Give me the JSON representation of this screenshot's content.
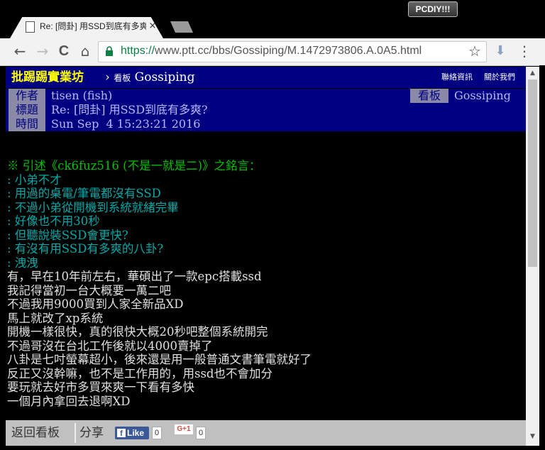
{
  "badge": "PCDIY!!!",
  "tab": {
    "title": "Re: [問卦] 用SSD到底有多爽",
    "close": "×"
  },
  "toolbar": {
    "back": "←",
    "forward": "→",
    "reload": "C",
    "home": "⌂",
    "url_scheme": "https://",
    "url_rest": "www.ptt.cc/bbs/Gossiping/M.1472973806.A.0A5.html",
    "star": "☆",
    "download": "⬇",
    "menu": "⋮"
  },
  "header": {
    "site": "批踢踢實業坊",
    "arrow": "›",
    "board_label": "看板",
    "board": "Gossiping",
    "contact": "聯絡資訊",
    "about": "關於我們"
  },
  "meta": {
    "author_tag": "作者",
    "author": "tisen (fish)",
    "board_tag": "看板",
    "board": "Gossiping",
    "title_tag": "標題",
    "title": "Re: [問卦] 用SSD到底有多爽?",
    "time_tag": "時間",
    "time": "Sun Sep  4 15:23:21 2016"
  },
  "quote_header": "※ 引述《ck6fuz516 (不是一就是二)》之銘言：",
  "quotes": [
    ": 小弟不才",
    ": 用過的桌電/筆電都沒有SSD",
    ": 不過小弟從開機到系統就緒完畢",
    ": 好像也不用30秒",
    ": 但聽說裝SSD會更快?",
    ": 有沒有用SSD有多爽的八卦?",
    ": 洩洩"
  ],
  "body": [
    "有，早在10年前左右，華碩出了一款epc搭載ssd",
    "我記得當初一台大概要一萬二吧",
    "不過我用9000買到人家全新品XD",
    "馬上就改了xp系統",
    "開機一樣很快，真的很快大概20秒吧整個系統開完",
    "不過哥沒在台北工作後就以4000賣掉了",
    "八卦是七吋螢幕超小，後來還是用一般普通文書筆電就好了",
    "反正又沒幹嘛，也不是工作用的，用ssd也不會加分",
    "要玩就去好市多買來爽一下看有多快",
    "一個月內拿回去退啊XD"
  ],
  "footer": {
    "back": "返回看板",
    "share": "分享",
    "fb_like": "Like",
    "fb_count": "0",
    "gplus": "G+1",
    "gplus_count": "0"
  }
}
